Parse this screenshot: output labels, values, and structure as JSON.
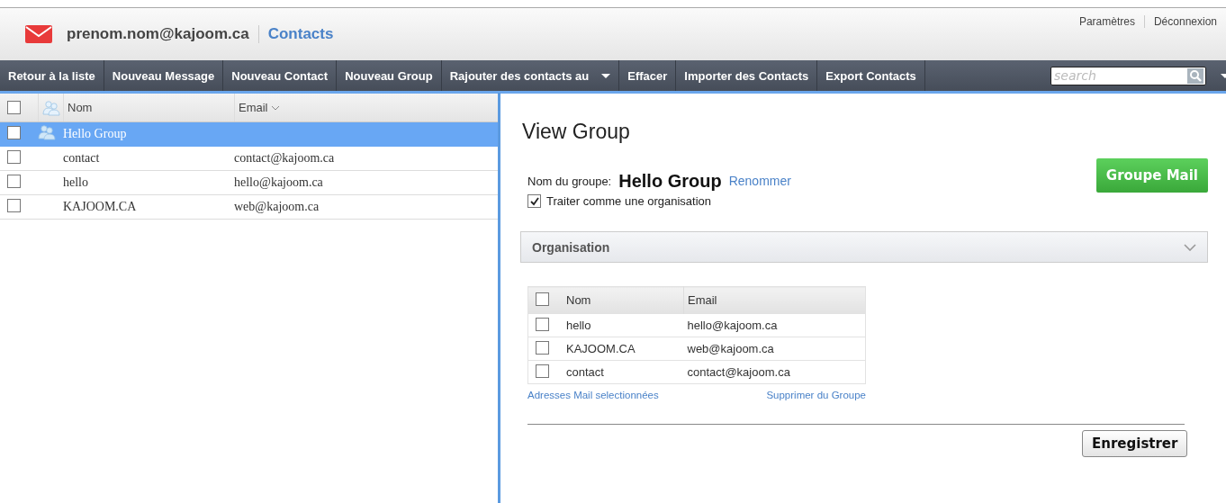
{
  "header": {
    "account": "prenom.nom@kajoom.ca",
    "app": "Contacts",
    "links": [
      "Paramètres",
      "Déconnexion"
    ]
  },
  "toolbar": {
    "buttons": [
      {
        "label": "Retour à la liste",
        "kind": "plain"
      },
      {
        "label": "Nouveau Message",
        "kind": "plain"
      },
      {
        "label": "Nouveau Contact",
        "kind": "plain"
      },
      {
        "label": "Nouveau Group",
        "kind": "plain"
      },
      {
        "label": "Rajouter des contacts au",
        "kind": "dropdown"
      },
      {
        "label": "Effacer",
        "kind": "plain"
      },
      {
        "label": "Importer des Contacts",
        "kind": "plain"
      },
      {
        "label": "Export Contacts",
        "kind": "plain"
      }
    ],
    "search": {
      "placeholder": "search"
    }
  },
  "contact_list": {
    "columns": [
      "Nom",
      "Email"
    ],
    "all_checked": false,
    "rows": [
      {
        "name": "Hello Group",
        "email": "",
        "kind": "group",
        "selected": true,
        "checked": false
      },
      {
        "name": "contact",
        "email": "contact@kajoom.ca",
        "kind": "contact",
        "selected": false,
        "checked": false
      },
      {
        "name": "hello",
        "email": "hello@kajoom.ca",
        "kind": "contact",
        "selected": false,
        "checked": false
      },
      {
        "name": "KAJOOM.CA",
        "email": "web@kajoom.ca",
        "kind": "contact",
        "selected": false,
        "checked": false
      }
    ]
  },
  "view_group": {
    "title": "View Group",
    "name_label": "Nom du groupe:",
    "group_name": "Hello Group",
    "rename": "Renommer",
    "mail_button": "Groupe Mail",
    "organisation_checkbox": {
      "label": "Traiter comme une organisation",
      "checked": true
    },
    "section": {
      "title": "Organisation",
      "expanded": false
    },
    "members": {
      "columns": [
        "Nom",
        "Email"
      ],
      "all_checked": false,
      "rows": [
        {
          "name": "hello",
          "email": "hello@kajoom.ca",
          "checked": false
        },
        {
          "name": "KAJOOM.CA",
          "email": "web@kajoom.ca",
          "checked": false
        },
        {
          "name": "contact",
          "email": "contact@kajoom.ca",
          "checked": false
        }
      ]
    },
    "links": [
      "Adresses Mail selectionnées",
      "Supprimer du Groupe"
    ],
    "save_button": "Enregistrer"
  }
}
